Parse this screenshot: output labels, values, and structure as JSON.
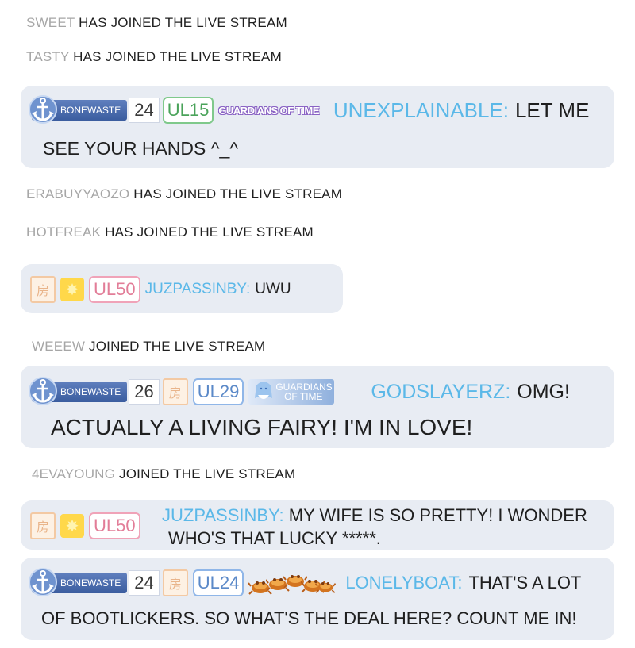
{
  "chat": {
    "sys1": {
      "user": "SWEET",
      "text": "HAS JOINED THE LIVE STREAM"
    },
    "sys2": {
      "user": "TASTY",
      "text": "HAS JOINED THE LIVE STREAM"
    },
    "msg1": {
      "fan_badge": "BONEWASTE",
      "level": "24",
      "ul": "UL15",
      "guild": "GUARDIANS OF TIME",
      "user": "UNEXPLAINABLE:",
      "line1": "LET ME",
      "line2": "SEE YOUR HANDS ^_^"
    },
    "sys3": {
      "user": "ERABUYYAOZO",
      "text": "HAS JOINED THE LIVE STREAM"
    },
    "sys4": {
      "user": "HOTFREAK",
      "text": "HAS JOINED THE LIVE STREAM"
    },
    "msg2": {
      "badge_char": "房",
      "ul": "UL50",
      "user": "JUZPASSINBY:",
      "line1": "UWU"
    },
    "sys5": {
      "user": "WEEEW",
      "text": "JOINED THE LIVE STREAM"
    },
    "msg3": {
      "fan_badge": "BONEWASTE",
      "level": "26",
      "badge_char": "房",
      "ul": "UL29",
      "guild_line1": "GUARDIANS",
      "guild_line2": "OF TIME",
      "user": "GODSLAYERZ:",
      "line1": "OMG!",
      "line2": "ACTUALLY A LIVING FAIRY! I'M IN LOVE!"
    },
    "sys6": {
      "user": "4EVAYOUNG",
      "text": "JOINED THE LIVE STREAM"
    },
    "msg4": {
      "badge_char": "房",
      "ul": "UL50",
      "user": "JUZPASSINBY:",
      "line1": "MY WIFE IS SO PRETTY! I WONDER",
      "line2": "WHO'S THAT LUCKY *****."
    },
    "msg5": {
      "fan_badge": "BONEWASTE",
      "level": "24",
      "badge_char": "房",
      "ul": "UL24",
      "user": "LONELYBOAT:",
      "line1": "THAT'S A LOT",
      "line2": "OF BOOTLICKERS. SO WHAT'S THE DEAL HERE? COUNT ME IN!"
    }
  },
  "colors": {
    "bubble": "#e8ecf3",
    "username": "#5bb8e8",
    "system_user": "#a6a6a6",
    "fan_badge": "#3b5d9f",
    "ul_green": "#4aa35a",
    "ul_pink": "#e27d98",
    "ul_blue": "#5b89c8"
  },
  "icons": [
    "anchor-icon",
    "house-badge-icon",
    "star-badge-icon",
    "fairy-icon",
    "crab-gift-icon"
  ]
}
